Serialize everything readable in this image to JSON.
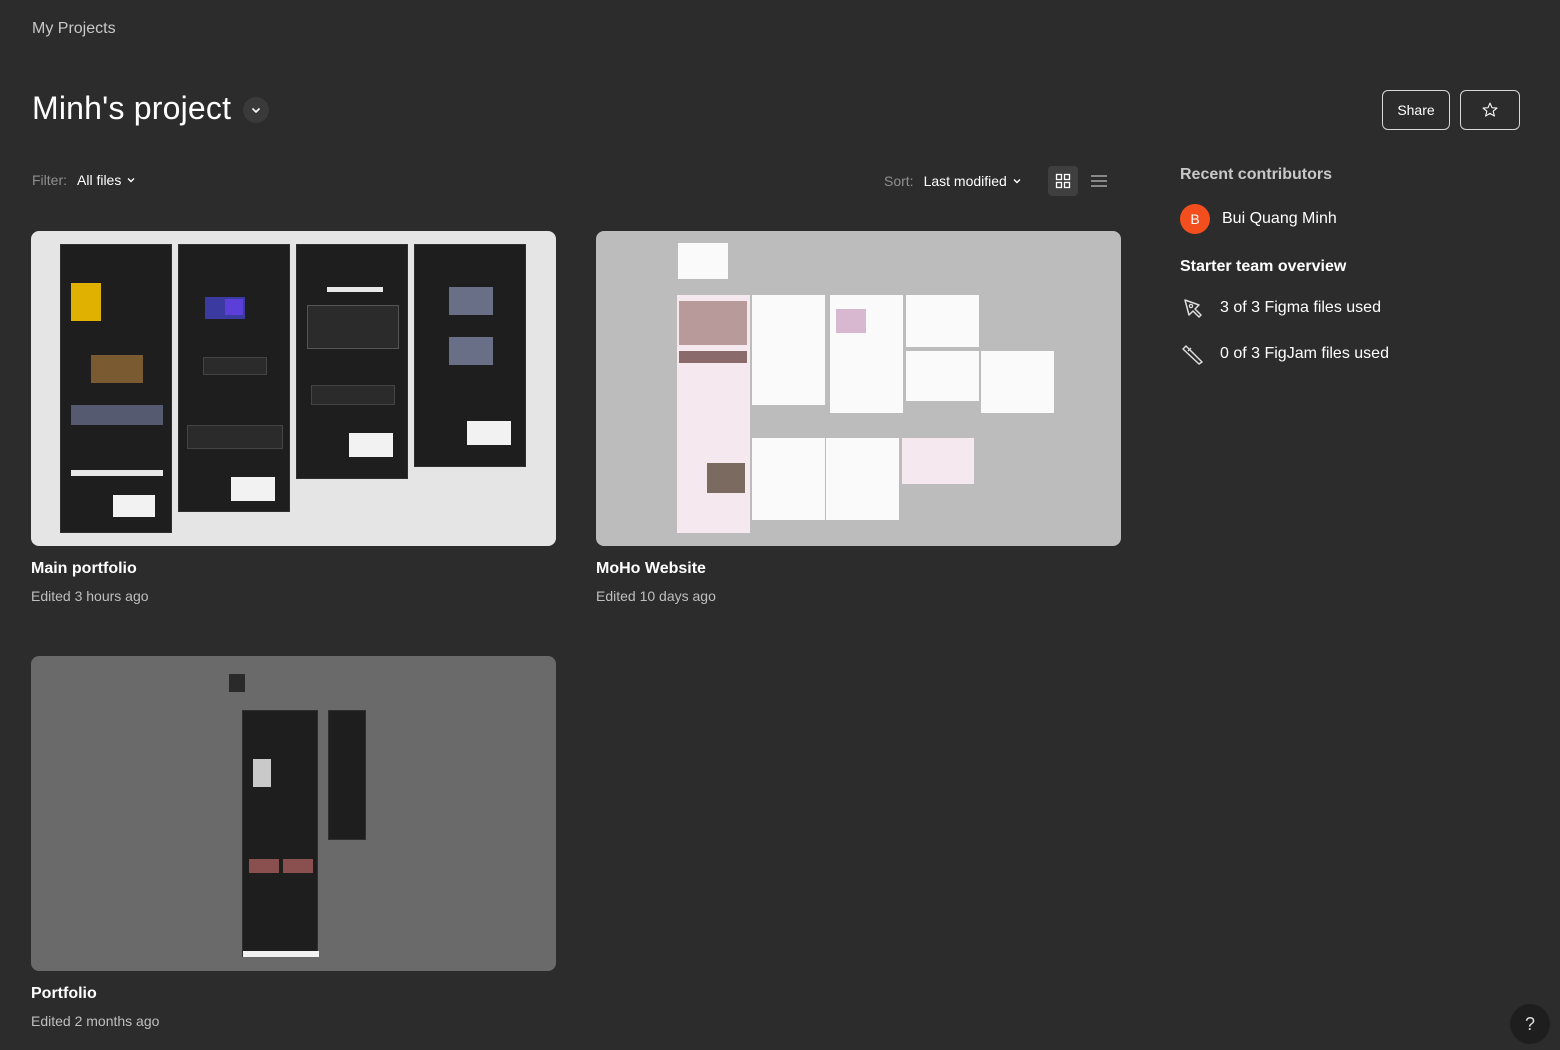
{
  "breadcrumb": "My Projects",
  "project": {
    "title": "Minh's project"
  },
  "actions": {
    "share_label": "Share",
    "star_icon": "star-icon"
  },
  "filter": {
    "label": "Filter:",
    "value": "All files"
  },
  "sort": {
    "label": "Sort:",
    "value": "Last modified"
  },
  "view": {
    "active": "grid"
  },
  "files": [
    {
      "name": "Main portfolio",
      "edited": "Edited 3 hours ago"
    },
    {
      "name": "MoHo Website",
      "edited": "Edited 10 days ago"
    },
    {
      "name": "Portfolio",
      "edited": "Edited 2 months ago"
    }
  ],
  "sidebar": {
    "contributors_heading": "Recent contributors",
    "contributors": [
      {
        "initial": "B",
        "name": "Bui Quang Minh"
      }
    ],
    "overview_heading": "Starter team overview",
    "usage": [
      {
        "icon": "pen-tool-icon",
        "text": "3 of 3 Figma files used"
      },
      {
        "icon": "marker-icon",
        "text": "0 of 3 FigJam files used"
      }
    ]
  },
  "help": {
    "label": "?"
  },
  "colors": {
    "background": "#2c2c2c",
    "avatar": "#f24e1e",
    "thumb_main": "#e5e5e5",
    "thumb_moho": "#bcbcbc",
    "thumb_portfolio": "#6a6a6a"
  }
}
